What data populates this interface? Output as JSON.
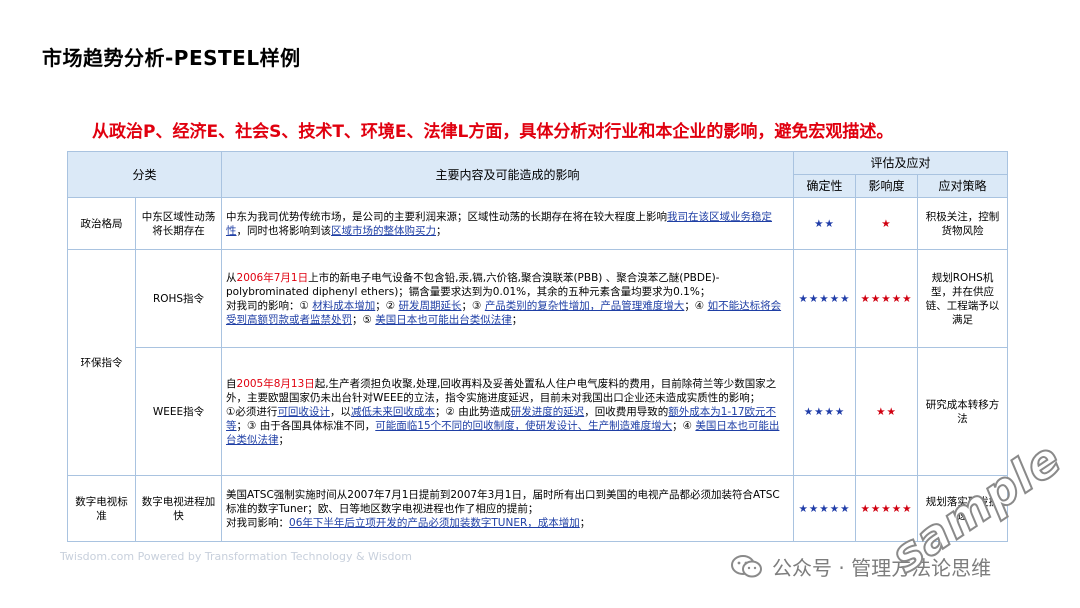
{
  "title": "市场趋势分析-PESTEL样例",
  "subtitle": "从政治P、经济E、社会S、技术T、环境E、法律L方面，具体分析对行业和本企业的影响，避免宏观描述。",
  "headers": {
    "category": "分类",
    "content": "主要内容及可能造成的影响",
    "eval": "评估及应对",
    "certainty": "确定性",
    "impact": "影响度",
    "strategy": "应对策略"
  },
  "rows": {
    "politics": {
      "category": "政治格局",
      "sub": "中东区域性动荡将长期存在",
      "text_a": "中东为我司优势传统市场，是公司的主要利润来源；区域性动荡的长期存在将在较大程度上影响",
      "link_a": "我司在该区域业务稳定性",
      "text_b": "，同时也将影响到该",
      "link_b": "区域市场的整体购买力",
      "text_c": "；",
      "certainty": "★★",
      "impact": "★",
      "strategy": "积极关注，控制货物风险"
    },
    "env_group": "环保指令",
    "rohs": {
      "sub": "ROHS指令",
      "p1": "从",
      "date": "2006年7月1日",
      "p2": "上市的新电子电气设备不包含铅,汞,镉,六价铬,聚合溴联苯(PBB) 、聚合溴苯乙醚(PBDE)-polybrominated diphenyl ethers)；镉含量要求达到为0.01%，其余的五种元素含量均要求为0.1%；",
      "p3": "对我司的影响：① ",
      "l1": "材料成本增加",
      "s1": "；② ",
      "l2": "研发周期延长",
      "s2": "；③ ",
      "l3": "产品类别的复杂性增加，产品管理难度增大",
      "s3": "；④ ",
      "l4": "如不能达标将会受到高额罚款或者监禁处罚",
      "s4": "；⑤ ",
      "l5": "美国日本也可能出台类似法律",
      "s5": "；",
      "certainty": "★★★★★",
      "impact": "★★★★★",
      "strategy": "规划ROHS机型，并在供应链、工程端予以满足"
    },
    "weee": {
      "sub": "WEEE指令",
      "p1": "自",
      "date": "2005年8月13日",
      "p2": "起,生产者须担负收聚,处理,回收再料及妥善处置私人住户电气废料的费用，目前除荷兰等少数国家之外，主要欧盟国家仍未出台针对WEEE的立法，指令实施进度延迟，目前未对我国出口企业还未造成实质性的影响；",
      "p3": "①必须进行",
      "l1": "可回收设计",
      "s1": "，以",
      "l2": "减低未来回收成本",
      "s2": "；② 由此势造成",
      "l3": "研发进度的延迟",
      "s3": "，回收费用导致的",
      "l4": "额外成本为1-17欧元不等",
      "s4": "；③ 由于各国具体标准不同，",
      "l5": "可能面临15个不同的回收制度，使研发设计、生产制造难度增大",
      "s5": "；④ ",
      "l6": "美国日本也可能出台类似法律",
      "s6": "；",
      "certainty": "★★★★",
      "impact": "★★",
      "strategy": "研究成本转移方法"
    },
    "dtv": {
      "category": "数字电视标准",
      "sub": "数字电视进程加快",
      "p1": "美国ATSC强制实施时间从2007年7月1日提前到2007年3月1日，届时所有出口到美国的电视产品都必须加装符合ATSC标准的数字Tuner；欧、日等地区数字电视进程也作了相应的提前；",
      "p2": "对我司影响：",
      "l1": "06年下半年后立项开发的产品必须加装数字TUNER，成本增加",
      "s1": "；",
      "certainty": "★★★★★",
      "impact": "★★★★★",
      "strategy": "规划落实研发提速"
    }
  },
  "footer_faint": "Twisdom.com Powered by Transformation Technology & Wisdom",
  "wechat_label": "公众号 · 管理方法论思维",
  "watermark": "sample",
  "colors": {
    "accent_red": "#e0000f",
    "link_blue": "#1f3fa5",
    "header_bg": "#dbe9f7",
    "border": "#a9c3e0"
  }
}
